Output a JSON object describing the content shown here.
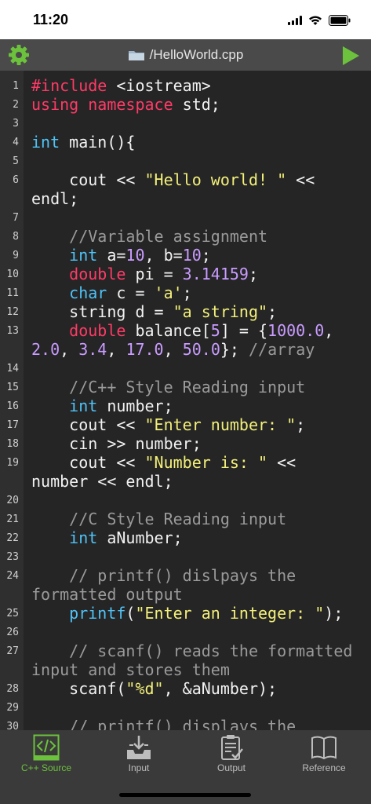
{
  "status_bar": {
    "time": "11:20"
  },
  "nav": {
    "title": "/HelloWorld.cpp",
    "settings_icon": "gear-icon",
    "run_icon": "play-icon"
  },
  "colors": {
    "keyword": "#ff3a66",
    "type": "#4fc3f7",
    "string": "#f3f07a",
    "number": "#c99cff",
    "comment": "#9a9a9a",
    "accent": "#6cc23c"
  },
  "code_lines": [
    {
      "n": "1",
      "segs": [
        [
          "kw",
          "#include "
        ],
        [
          "",
          "<iostream>"
        ]
      ]
    },
    {
      "n": "2",
      "segs": [
        [
          "kw",
          "using namespace "
        ],
        [
          "",
          "std;"
        ]
      ]
    },
    {
      "n": "3",
      "segs": []
    },
    {
      "n": "4",
      "segs": [
        [
          "ty",
          "int "
        ],
        [
          "",
          "main(){"
        ]
      ]
    },
    {
      "n": "5",
      "segs": []
    },
    {
      "n": "6",
      "segs": [
        [
          "",
          "    cout << "
        ],
        [
          "str",
          "\"Hello world! \""
        ],
        [
          "",
          " <<"
        ]
      ]
    },
    {
      "n": "",
      "segs": [
        [
          "",
          "endl;"
        ]
      ]
    },
    {
      "n": "7",
      "segs": []
    },
    {
      "n": "8",
      "segs": [
        [
          "cm",
          "    //Variable assignment"
        ]
      ]
    },
    {
      "n": "9",
      "segs": [
        [
          "ty",
          "    int "
        ],
        [
          "",
          "a="
        ],
        [
          "num",
          "10"
        ],
        [
          "",
          ", b="
        ],
        [
          "num",
          "10"
        ],
        [
          "",
          ";"
        ]
      ]
    },
    {
      "n": "10",
      "segs": [
        [
          "kw",
          "    double "
        ],
        [
          "",
          "pi = "
        ],
        [
          "num",
          "3.14159"
        ],
        [
          "",
          ";"
        ]
      ]
    },
    {
      "n": "11",
      "segs": [
        [
          "ty",
          "    char "
        ],
        [
          "",
          "c = "
        ],
        [
          "str",
          "'a'"
        ],
        [
          "",
          ";"
        ]
      ]
    },
    {
      "n": "12",
      "segs": [
        [
          "",
          "    string d = "
        ],
        [
          "str",
          "\"a string\""
        ],
        [
          "",
          ";"
        ]
      ]
    },
    {
      "n": "13",
      "segs": [
        [
          "kw",
          "    double "
        ],
        [
          "",
          "balance["
        ],
        [
          "num",
          "5"
        ],
        [
          "",
          "] = {"
        ],
        [
          "num",
          "1000.0"
        ],
        [
          "",
          ","
        ]
      ]
    },
    {
      "n": "",
      "segs": [
        [
          "num",
          "2.0"
        ],
        [
          "",
          ", "
        ],
        [
          "num",
          "3.4"
        ],
        [
          "",
          ", "
        ],
        [
          "num",
          "17.0"
        ],
        [
          "",
          ", "
        ],
        [
          "num",
          "50.0"
        ],
        [
          "",
          "}; "
        ],
        [
          "cm",
          "//array"
        ]
      ]
    },
    {
      "n": "14",
      "segs": []
    },
    {
      "n": "15",
      "segs": [
        [
          "cm",
          "    //C++ Style Reading input"
        ]
      ]
    },
    {
      "n": "16",
      "segs": [
        [
          "ty",
          "    int "
        ],
        [
          "",
          "number;"
        ]
      ]
    },
    {
      "n": "17",
      "segs": [
        [
          "",
          "    cout << "
        ],
        [
          "str",
          "\"Enter number: \""
        ],
        [
          "",
          ";"
        ]
      ]
    },
    {
      "n": "18",
      "segs": [
        [
          "",
          "    cin >> number;"
        ]
      ]
    },
    {
      "n": "19",
      "segs": [
        [
          "",
          "    cout << "
        ],
        [
          "str",
          "\"Number is: \""
        ],
        [
          "",
          " <<"
        ]
      ]
    },
    {
      "n": "",
      "segs": [
        [
          "",
          "number << endl;"
        ]
      ]
    },
    {
      "n": "20",
      "segs": []
    },
    {
      "n": "21",
      "segs": [
        [
          "cm",
          "    //C Style Reading input"
        ]
      ]
    },
    {
      "n": "22",
      "segs": [
        [
          "ty",
          "    int "
        ],
        [
          "",
          "aNumber;"
        ]
      ]
    },
    {
      "n": "23",
      "segs": []
    },
    {
      "n": "24",
      "segs": [
        [
          "cm",
          "    // printf() dislpays the"
        ]
      ]
    },
    {
      "n": "",
      "segs": [
        [
          "cm",
          "formatted output"
        ]
      ]
    },
    {
      "n": "25",
      "segs": [
        [
          "ty",
          "    printf"
        ],
        [
          "",
          "("
        ],
        [
          "str",
          "\"Enter an integer: \""
        ],
        [
          "",
          ");"
        ]
      ]
    },
    {
      "n": "26",
      "segs": []
    },
    {
      "n": "27",
      "segs": [
        [
          "cm",
          "    // scanf() reads the formatted"
        ]
      ]
    },
    {
      "n": "",
      "segs": [
        [
          "cm",
          "input and stores them"
        ]
      ]
    },
    {
      "n": "28",
      "segs": [
        [
          "",
          "    scanf("
        ],
        [
          "str",
          "\"%d\""
        ],
        [
          "",
          ", &aNumber);"
        ]
      ]
    },
    {
      "n": "29",
      "segs": []
    },
    {
      "n": "30",
      "segs": [
        [
          "cm",
          "    // printf() displays the"
        ]
      ]
    }
  ],
  "tabs": [
    {
      "label": "C++ Source",
      "icon": "code-icon",
      "active": true
    },
    {
      "label": "Input",
      "icon": "input-tray-icon",
      "active": false
    },
    {
      "label": "Output",
      "icon": "output-clipboard-icon",
      "active": false
    },
    {
      "label": "Reference",
      "icon": "book-icon",
      "active": false
    }
  ]
}
